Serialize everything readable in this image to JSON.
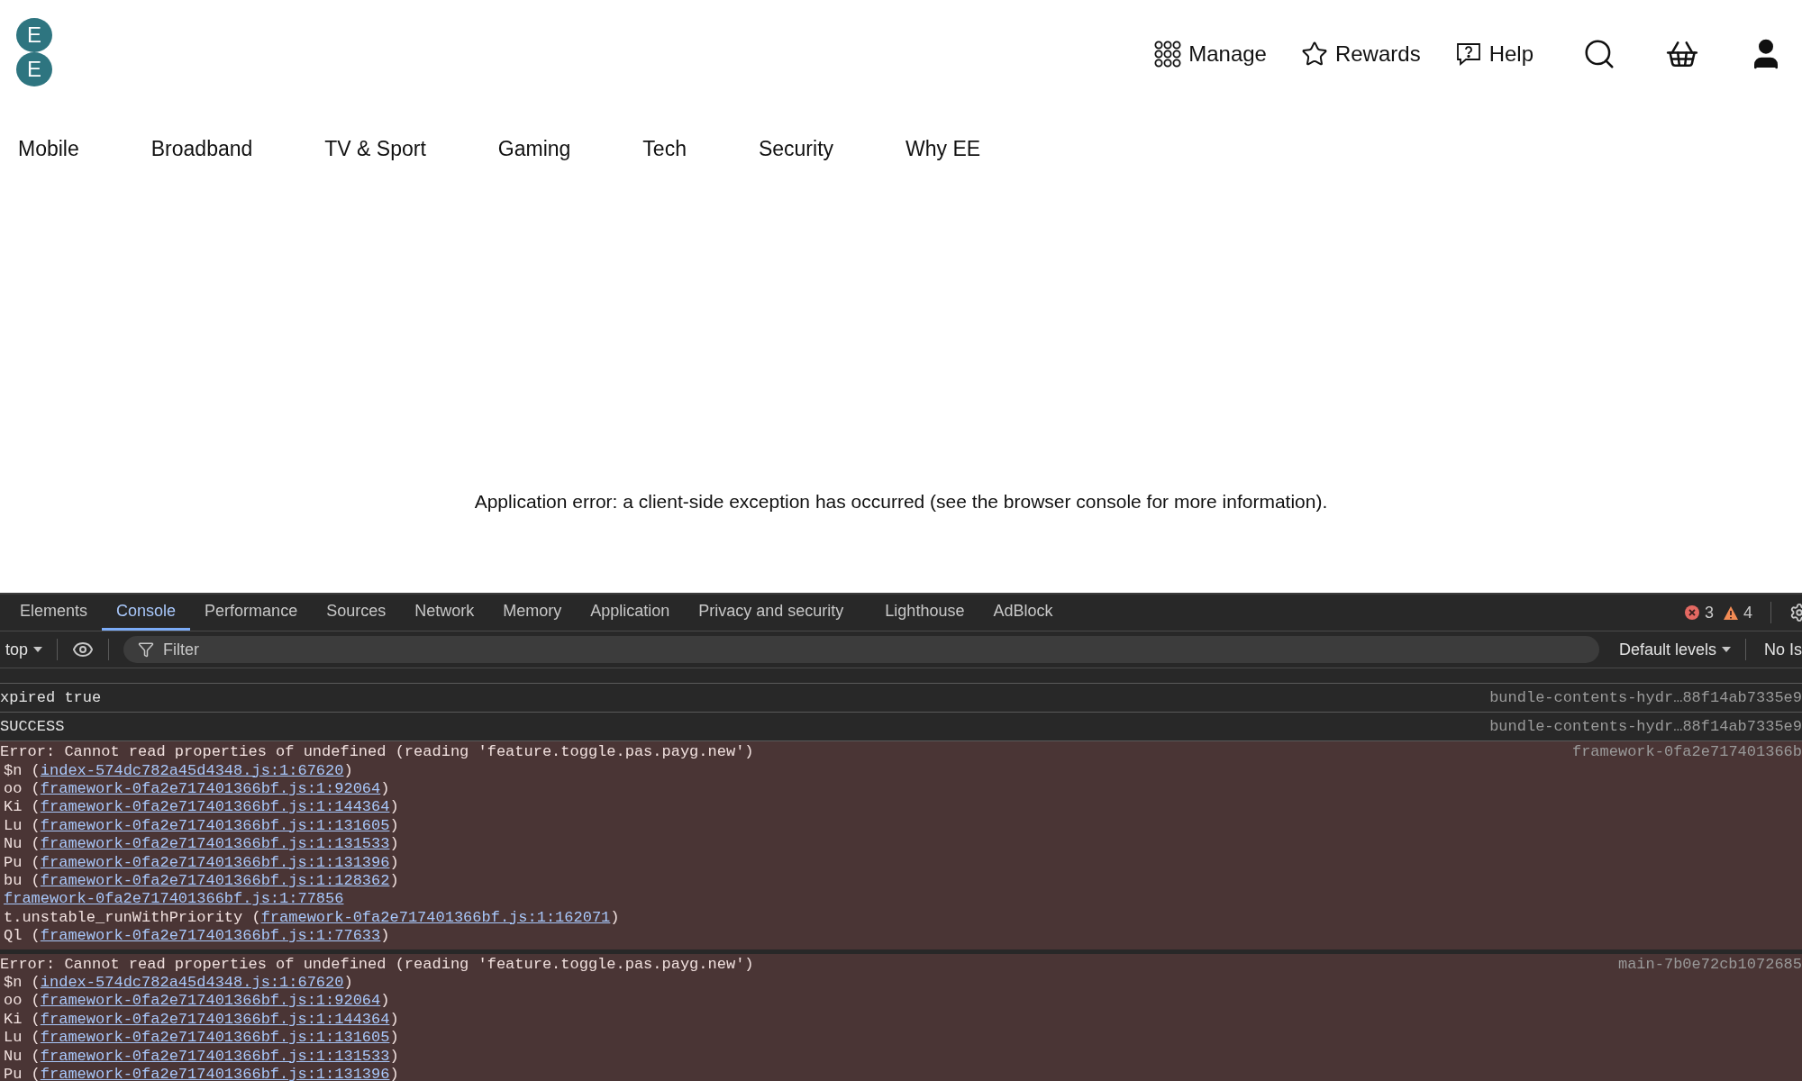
{
  "header": {
    "logo_letters": [
      "E",
      "E"
    ],
    "utility_links": [
      {
        "kind": "grid",
        "label": "Manage"
      },
      {
        "kind": "star",
        "label": "Rewards"
      },
      {
        "kind": "help",
        "label": "Help"
      }
    ],
    "icon_buttons": [
      {
        "kind": "search"
      },
      {
        "kind": "basket"
      },
      {
        "kind": "account"
      }
    ]
  },
  "nav": [
    "Mobile",
    "Broadband",
    "TV & Sport",
    "Gaming",
    "Tech",
    "Security",
    "Why EE"
  ],
  "message": "Application error: a client-side exception has occurred (see the browser console for more information).",
  "devtools": {
    "tabs": [
      {
        "label": "Elements",
        "selected": false
      },
      {
        "label": "Console",
        "selected": true
      },
      {
        "label": "Performance",
        "selected": false
      },
      {
        "label": "Sources",
        "selected": false
      },
      {
        "label": "Network",
        "selected": false
      },
      {
        "label": "Memory",
        "selected": false
      },
      {
        "label": "Application",
        "selected": false
      },
      {
        "label": "Privacy and security",
        "selected": false
      },
      {
        "label": "Lighthouse",
        "selected": false
      },
      {
        "label": "AdBlock",
        "selected": false
      }
    ],
    "error_count": "3",
    "warning_count": "4",
    "context": "top",
    "filter_placeholder": "Filter",
    "levels": "Default levels",
    "issues": "No Is",
    "rows": [
      {
        "kind": "log",
        "text": "xpired true",
        "source": "bundle-contents-hydr…88f14ab7335e9"
      },
      {
        "kind": "log",
        "text": "SUCCESS",
        "source": "bundle-contents-hydr…88f14ab7335e9"
      },
      {
        "kind": "error",
        "text": "Error: Cannot read properties of undefined (reading 'feature.toggle.pas.payg.new')",
        "source": "framework-0fa2e717401366b",
        "stack": [
          {
            "prefix": "$n (",
            "link": "index-574dc782a45d4348.js:1:67620",
            "suffix": ")"
          },
          {
            "prefix": "oo (",
            "link": "framework-0fa2e717401366bf.js:1:92064",
            "suffix": ")"
          },
          {
            "prefix": "Ki (",
            "link": "framework-0fa2e717401366bf.js:1:144364",
            "suffix": ")"
          },
          {
            "prefix": "Lu (",
            "link": "framework-0fa2e717401366bf.js:1:131605",
            "suffix": ")"
          },
          {
            "prefix": "Nu (",
            "link": "framework-0fa2e717401366bf.js:1:131533",
            "suffix": ")"
          },
          {
            "prefix": "Pu (",
            "link": "framework-0fa2e717401366bf.js:1:131396",
            "suffix": ")"
          },
          {
            "prefix": "bu (",
            "link": "framework-0fa2e717401366bf.js:1:128362",
            "suffix": ")"
          },
          {
            "link": "framework-0fa2e717401366bf.js:1:77856"
          },
          {
            "prefix": "t.unstable_runWithPriority (",
            "link": "framework-0fa2e717401366bf.js:1:162071",
            "suffix": ")"
          },
          {
            "prefix": "Ql (",
            "link": "framework-0fa2e717401366bf.js:1:77633",
            "suffix": ")"
          }
        ]
      },
      {
        "kind": "error",
        "text": "Error: Cannot read properties of undefined (reading 'feature.toggle.pas.payg.new')",
        "source": "main-7b0e72cb1072685",
        "stack": [
          {
            "prefix": "$n (",
            "link": "index-574dc782a45d4348.js:1:67620",
            "suffix": ")"
          },
          {
            "prefix": "oo (",
            "link": "framework-0fa2e717401366bf.js:1:92064",
            "suffix": ")"
          },
          {
            "prefix": "Ki (",
            "link": "framework-0fa2e717401366bf.js:1:144364",
            "suffix": ")"
          },
          {
            "prefix": "Lu (",
            "link": "framework-0fa2e717401366bf.js:1:131605",
            "suffix": ")"
          },
          {
            "prefix": "Nu (",
            "link": "framework-0fa2e717401366bf.js:1:131533",
            "suffix": ")"
          },
          {
            "prefix": "Pu (",
            "link": "framework-0fa2e717401366bf.js:1:131396",
            "suffix": ")"
          }
        ]
      }
    ]
  }
}
